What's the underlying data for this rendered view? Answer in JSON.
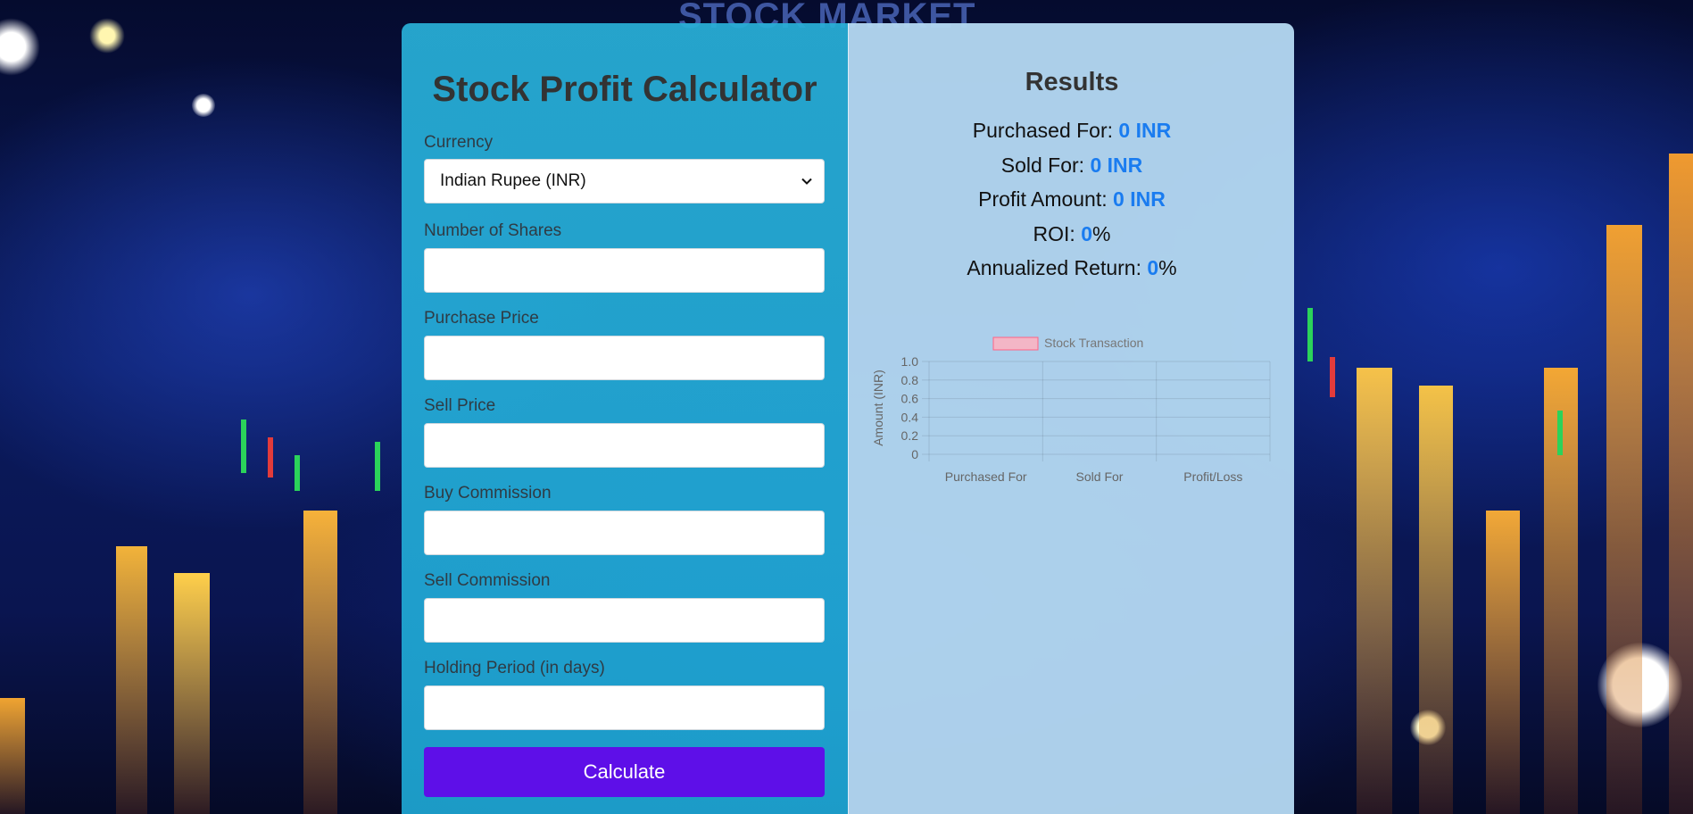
{
  "background": {
    "watermark": "STOCK MARKET"
  },
  "calculator": {
    "title": "Stock Profit Calculator",
    "currency_label": "Currency",
    "currency_value": "Indian Rupee (INR)",
    "shares_label": "Number of Shares",
    "purchase_price_label": "Purchase Price",
    "sell_price_label": "Sell Price",
    "buy_commission_label": "Buy Commission",
    "sell_commission_label": "Sell Commission",
    "holding_period_label": "Holding Period (in days)",
    "calculate_label": "Calculate"
  },
  "results": {
    "title": "Results",
    "purchased_label": "Purchased For: ",
    "purchased_value": "0 INR",
    "sold_label": "Sold For: ",
    "sold_value": "0 INR",
    "profit_label": "Profit Amount: ",
    "profit_value": "0 INR",
    "roi_label": "ROI: ",
    "roi_value": "0",
    "roi_unit": "%",
    "annual_label": "Annualized Return: ",
    "annual_value": "0",
    "annual_unit": "%"
  },
  "chart_data": {
    "type": "bar",
    "categories": [
      "Purchased For",
      "Sold For",
      "Profit/Loss"
    ],
    "series": [
      {
        "name": "Stock Transaction",
        "values": [
          0,
          0,
          0
        ]
      }
    ],
    "ylabel": "Amount (INR)",
    "ylim": [
      0,
      1
    ],
    "yticks": [
      "0",
      "0.2",
      "0.4",
      "0.6",
      "0.8",
      "1.0"
    ],
    "grid": true,
    "legend": "top",
    "colors": {
      "fill": "#f3b6c6",
      "border": "#ff6384"
    }
  }
}
